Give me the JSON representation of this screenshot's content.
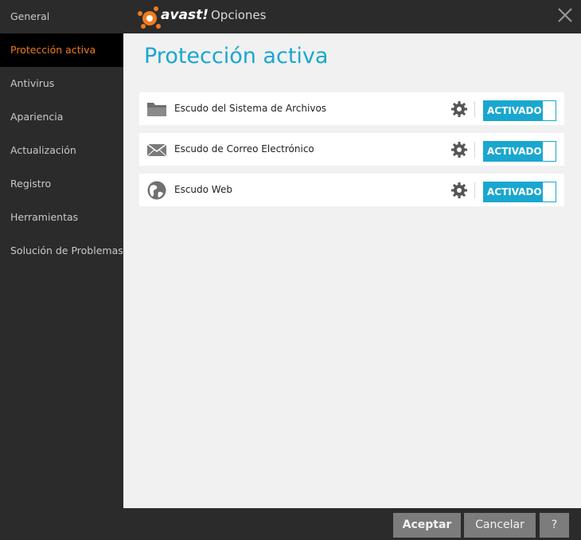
{
  "window": {
    "brand": "avast!",
    "title": "Opciones",
    "accent": "#1aa7cf",
    "orange": "#f07b1e"
  },
  "sidebar": {
    "items": [
      {
        "label": "General"
      },
      {
        "label": "Protección activa"
      },
      {
        "label": "Antivirus"
      },
      {
        "label": "Apariencia"
      },
      {
        "label": "Actualización"
      },
      {
        "label": "Registro"
      },
      {
        "label": "Herramientas"
      },
      {
        "label": "Solución de Problemas"
      }
    ],
    "active_index": 1
  },
  "main": {
    "title": "Protección activa",
    "shields": [
      {
        "icon": "folder-icon",
        "label": "Escudo del Sistema de Archivos",
        "status": "ACTIVADO"
      },
      {
        "icon": "mail-icon",
        "label": "Escudo de Correo Electrónico",
        "status": "ACTIVADO"
      },
      {
        "icon": "globe-icon",
        "label": "Escudo Web",
        "status": "ACTIVADO"
      }
    ]
  },
  "footer": {
    "accept": "Aceptar",
    "cancel": "Cancelar",
    "help": "?"
  }
}
